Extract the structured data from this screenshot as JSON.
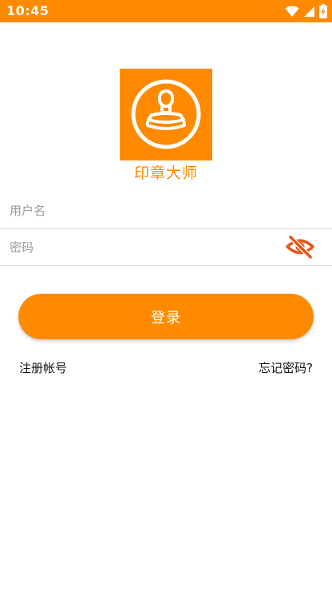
{
  "status_bar": {
    "time": "10:45",
    "icons": [
      "wifi-icon",
      "cellular-signal-icon",
      "battery-charging-icon"
    ]
  },
  "logo": {
    "icon": "stamp-icon",
    "app_name": "印章大师"
  },
  "form": {
    "username": {
      "placeholder": "用户名",
      "value": ""
    },
    "password": {
      "placeholder": "密码",
      "value": "",
      "visibility_icon": "eye-off-icon"
    }
  },
  "login_button": {
    "label": "登录"
  },
  "links": {
    "register": "注册帐号",
    "forgot_password": "忘记密码?"
  },
  "colors": {
    "accent": "#ff8a00",
    "eye_icon": "#e8541a",
    "divider": "#dcdcdc"
  }
}
